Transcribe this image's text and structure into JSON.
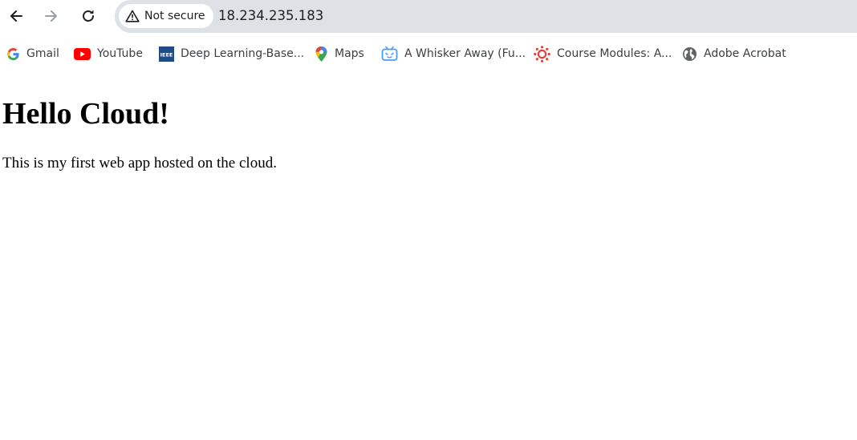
{
  "browser": {
    "security_label": "Not secure",
    "url": "18.234.235.183",
    "nav_icons": [
      "back-arrow-icon",
      "forward-arrow-icon",
      "reload-icon"
    ]
  },
  "bookmarks": [
    {
      "label": "Gmail",
      "icon": "google-icon"
    },
    {
      "label": "YouTube",
      "icon": "youtube-icon"
    },
    {
      "label": "Deep Learning-Base...",
      "icon": "ieee-icon"
    },
    {
      "label": "Maps",
      "icon": "maps-pin-icon"
    },
    {
      "label": "A Whisker Away (Fu...",
      "icon": "bilibili-icon"
    },
    {
      "label": "Course Modules: A...",
      "icon": "canvas-icon"
    },
    {
      "label": "Adobe Acrobat",
      "icon": "globe-icon"
    }
  ],
  "page": {
    "heading": "Hello Cloud!",
    "paragraph": "This is my first web app hosted on the cloud."
  },
  "colors": {
    "omnibox_bg": "#dee1e6",
    "youtube_red": "#ff0000",
    "ieee_blue": "#1e4c8a",
    "canvas_red": "#e2413b",
    "bilibili_blue": "#4a9df8"
  }
}
